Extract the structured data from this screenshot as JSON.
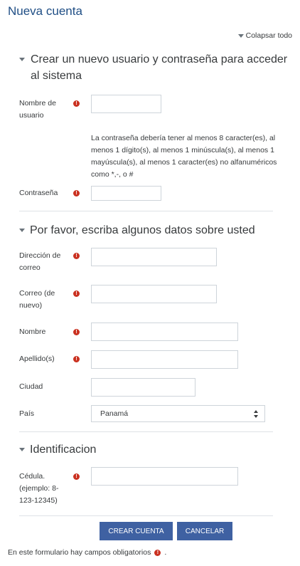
{
  "page": {
    "title": "Nueva cuenta",
    "collapse_all": "Colapsar todo"
  },
  "sections": [
    {
      "title": "Crear un nuevo usuario y contraseña para acceder al sistema"
    },
    {
      "title": "Por favor, escriba algunos datos sobre usted"
    },
    {
      "title": "Identificacion"
    }
  ],
  "fields": {
    "username": {
      "label": "Nombre de usuario",
      "value": ""
    },
    "password_hint": "La contraseña debería tener al menos 8 caracter(es), al menos 1 dígito(s), al menos 1 minúscula(s), al menos 1 mayúscula(s), al menos 1 caracter(es) no alfanuméricos como *,-, o #",
    "password": {
      "label": "Contraseña",
      "value": ""
    },
    "email": {
      "label": "Dirección de correo",
      "value": ""
    },
    "email2": {
      "label": "Correo (de nuevo)",
      "value": ""
    },
    "firstname": {
      "label": "Nombre",
      "value": ""
    },
    "lastname": {
      "label": "Apellido(s)",
      "value": ""
    },
    "city": {
      "label": "Ciudad",
      "value": ""
    },
    "country": {
      "label": "País",
      "value": "Panamá"
    },
    "cedula": {
      "label": "Cédula. (ejemplo: 8-123-12345)",
      "value": ""
    }
  },
  "buttons": {
    "submit": "CREAR CUENTA",
    "cancel": "CANCELAR"
  },
  "footer": {
    "required_note": "En este formulario hay campos obligatorios",
    "required_note_end": "."
  },
  "colors": {
    "title": "#1f4e85",
    "button": "#3f61a2",
    "required": "#ca3120"
  },
  "icons": {
    "required": "exclamation-circle-icon",
    "collapse": "caret-down-icon"
  }
}
